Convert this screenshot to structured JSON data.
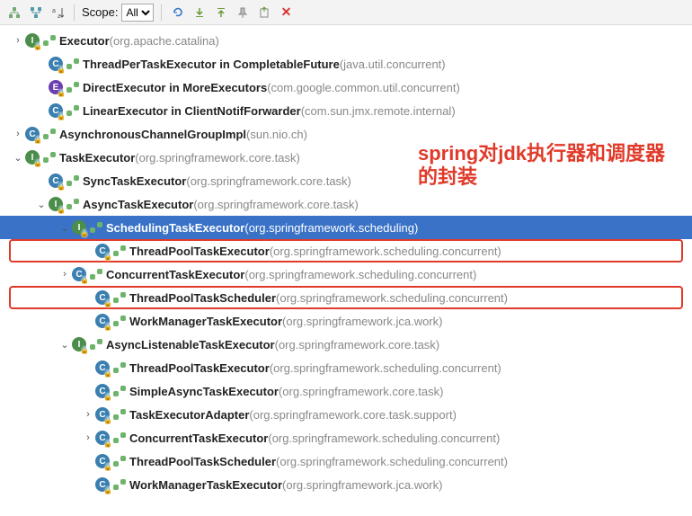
{
  "toolbar": {
    "scope_label": "Scope:",
    "scope_value": "All"
  },
  "annotation": "spring对jdk执行器和调度器的封装",
  "nodes": [
    {
      "indent": 0,
      "chev": "right",
      "kind": "i",
      "name": "Executor",
      "pkg": "(org.apache.catalina)"
    },
    {
      "indent": 1,
      "chev": "",
      "kind": "c",
      "name": "ThreadPerTaskExecutor in CompletableFuture",
      "pkg": "(java.util.concurrent)"
    },
    {
      "indent": 1,
      "chev": "",
      "kind": "e",
      "name": "DirectExecutor in MoreExecutors",
      "pkg": "(com.google.common.util.concurrent)"
    },
    {
      "indent": 1,
      "chev": "",
      "kind": "c",
      "name": "LinearExecutor in ClientNotifForwarder",
      "pkg": "(com.sun.jmx.remote.internal)"
    },
    {
      "indent": 0,
      "chev": "right",
      "kind": "c",
      "name": "AsynchronousChannelGroupImpl",
      "pkg": "(sun.nio.ch)"
    },
    {
      "indent": 0,
      "chev": "down",
      "kind": "i",
      "name": "TaskExecutor",
      "pkg": "(org.springframework.core.task)"
    },
    {
      "indent": 1,
      "chev": "",
      "kind": "c",
      "name": "SyncTaskExecutor",
      "pkg": "(org.springframework.core.task)"
    },
    {
      "indent": 1,
      "chev": "down",
      "kind": "i",
      "name": "AsyncTaskExecutor",
      "pkg": "(org.springframework.core.task)"
    },
    {
      "indent": 2,
      "chev": "down",
      "kind": "i",
      "name": "SchedulingTaskExecutor",
      "pkg": "(org.springframework.scheduling)",
      "selected": true
    },
    {
      "indent": 3,
      "chev": "",
      "kind": "c",
      "name": "ThreadPoolTaskExecutor",
      "pkg": "(org.springframework.scheduling.concurrent)",
      "boxed": true
    },
    {
      "indent": 2,
      "chev": "right",
      "kind": "c",
      "name": "ConcurrentTaskExecutor",
      "pkg": "(org.springframework.scheduling.concurrent)"
    },
    {
      "indent": 3,
      "chev": "",
      "kind": "c",
      "name": "ThreadPoolTaskScheduler",
      "pkg": "(org.springframework.scheduling.concurrent)",
      "boxed": true
    },
    {
      "indent": 3,
      "chev": "",
      "kind": "c",
      "name": "WorkManagerTaskExecutor",
      "pkg": "(org.springframework.jca.work)"
    },
    {
      "indent": 2,
      "chev": "down",
      "kind": "i",
      "name": "AsyncListenableTaskExecutor",
      "pkg": "(org.springframework.core.task)"
    },
    {
      "indent": 3,
      "chev": "",
      "kind": "c",
      "name": "ThreadPoolTaskExecutor",
      "pkg": "(org.springframework.scheduling.concurrent)"
    },
    {
      "indent": 3,
      "chev": "",
      "kind": "c",
      "name": "SimpleAsyncTaskExecutor",
      "pkg": "(org.springframework.core.task)"
    },
    {
      "indent": 3,
      "chev": "right",
      "kind": "c",
      "name": "TaskExecutorAdapter",
      "pkg": "(org.springframework.core.task.support)"
    },
    {
      "indent": 3,
      "chev": "right",
      "kind": "c",
      "name": "ConcurrentTaskExecutor",
      "pkg": "(org.springframework.scheduling.concurrent)"
    },
    {
      "indent": 3,
      "chev": "",
      "kind": "c",
      "name": "ThreadPoolTaskScheduler",
      "pkg": "(org.springframework.scheduling.concurrent)"
    },
    {
      "indent": 3,
      "chev": "",
      "kind": "c",
      "name": "WorkManagerTaskExecutor",
      "pkg": "(org.springframework.jca.work)"
    }
  ]
}
